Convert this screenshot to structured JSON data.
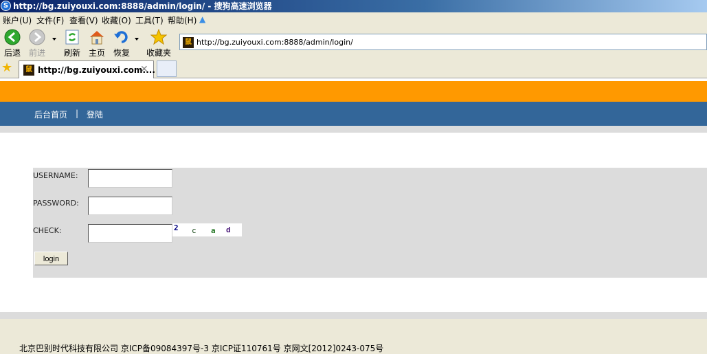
{
  "window": {
    "title": "http://bg.zuiyouxi.com:8888/admin/login/ - 搜狗高速浏览器"
  },
  "menubar": {
    "items": [
      "账户(U)",
      "文件(F)",
      "查看(V)",
      "收藏(O)",
      "工具(T)",
      "帮助(H)"
    ]
  },
  "toolbar": {
    "back": "后退",
    "forward": "前进",
    "refresh": "刷新",
    "home": "主页",
    "restore": "恢复",
    "favorites": "收藏夹"
  },
  "address": {
    "url": "http://bg.zuiyouxi.com:8888/admin/login/"
  },
  "tabs": [
    {
      "label": "http://bg.zuiyouxi.com:..."
    }
  ],
  "nav": {
    "home": "后台首页",
    "separator": "|",
    "login": "登陆"
  },
  "form": {
    "username_label": "USERNAME:",
    "password_label": "PASSWORD:",
    "check_label": "CHECK:",
    "username_value": "",
    "password_value": "",
    "check_value": "",
    "captcha": [
      "2",
      "c",
      "a",
      "d"
    ],
    "login_button": "login"
  },
  "footer": {
    "text": "北京巴别时代科技有限公司 京ICP备09084397号-3 京ICP证110761号 京网文[2012]0243-075号"
  },
  "colors": {
    "orange_band": "#ff9900",
    "nav_band": "#336699",
    "form_bg": "#dcdcdc"
  }
}
